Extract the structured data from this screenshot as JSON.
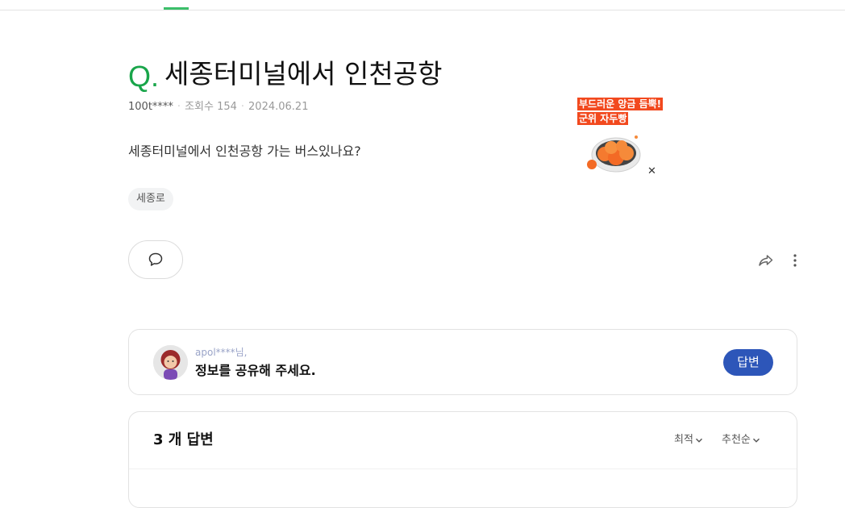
{
  "question": {
    "q_mark": "Q.",
    "title": "세종터미널에서 인천공항",
    "author": "100t****",
    "views": "조회수 154",
    "date": "2024.06.21",
    "body": "세종터미널에서 인천공항 가는 버스있나요?",
    "tag": "세종로"
  },
  "ad": {
    "line1": "부드러운 앙금 듬뿍!",
    "line2": "군위 자두빵",
    "close": "✕"
  },
  "request_card": {
    "requester": "apol****님,",
    "message": "정보를 공유해 주세요.",
    "answer_button": "답변"
  },
  "answers": {
    "count_label": "3 개 답변",
    "sort_latest": "최적",
    "sort_recommended": "추천순"
  },
  "colors": {
    "brand_green": "#19a54a",
    "answer_button": "#2d56b9",
    "ad_red": "#f2491e"
  }
}
